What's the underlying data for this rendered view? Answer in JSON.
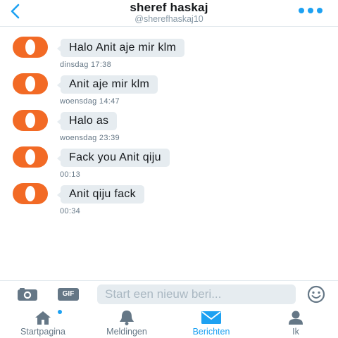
{
  "header": {
    "title": "sheref haskaj",
    "handle": "@sherefhaskaj10",
    "back_icon": "chevron-left-icon",
    "more_icon": "more-dots-icon",
    "accent_color": "#1da1f2"
  },
  "messages": [
    {
      "text": "Halo Anit aje mir klm",
      "time": "dinsdag 17:38"
    },
    {
      "text": "Anit aje mir klm",
      "time": "woensdag 14:47"
    },
    {
      "text": "Halo as",
      "time": "woensdag 23:39"
    },
    {
      "text": "Fack you Anit qiju",
      "time": "00:13"
    },
    {
      "text": "Anit qiju fack",
      "time": "00:34"
    }
  ],
  "composer": {
    "camera_icon": "camera-icon",
    "gif_label": "GIF",
    "placeholder": "Start een nieuw beri...",
    "value": "",
    "emoji_icon": "smiley-icon"
  },
  "tabbar": {
    "tabs": [
      {
        "label": "Startpagina",
        "icon": "home-icon",
        "active": false,
        "has_dot": true
      },
      {
        "label": "Meldingen",
        "icon": "bell-icon",
        "active": false
      },
      {
        "label": "Berichten",
        "icon": "envelope-icon",
        "active": true
      },
      {
        "label": "Ik",
        "icon": "person-icon",
        "active": false
      }
    ]
  },
  "colors": {
    "avatar": "#f26a25",
    "bubble": "#e6ecf0",
    "muted_text": "#657786"
  }
}
